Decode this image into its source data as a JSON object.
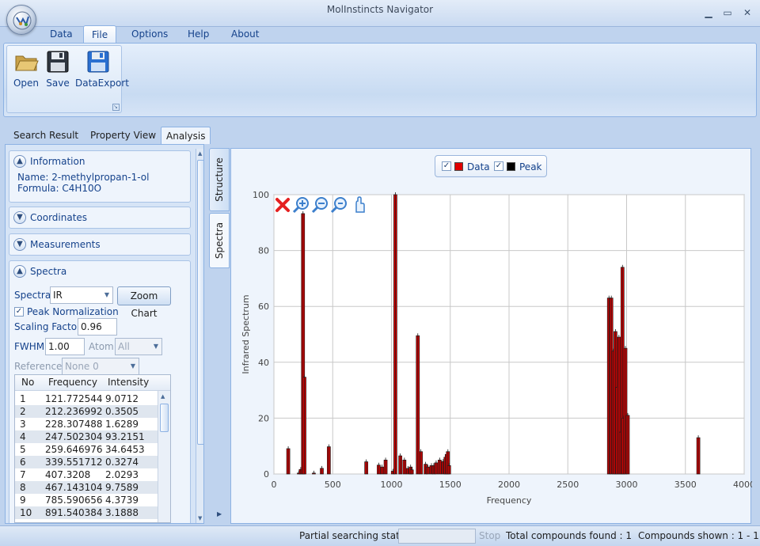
{
  "window": {
    "title": "MolInstincts Navigator",
    "min_glyph": "▁",
    "max_glyph": "▭",
    "close_glyph": "✕"
  },
  "menu": {
    "tabs": [
      "Data",
      "File",
      "Options",
      "Help",
      "About"
    ],
    "active": "File"
  },
  "ribbon": {
    "buttons": [
      {
        "label": "Open",
        "icon": "folder-open-icon"
      },
      {
        "label": "Save",
        "icon": "floppy-save-icon"
      },
      {
        "label": "DataExport",
        "icon": "data-export-icon"
      }
    ]
  },
  "page_tabs": {
    "items": [
      "Search Result",
      "Property View",
      "Analysis"
    ],
    "active": "Analysis"
  },
  "vertical_tabs": {
    "structure": "Structure",
    "spectra": "Spectra"
  },
  "left_panel": {
    "information": {
      "title": "Information",
      "name": "Name: 2-methylpropan-1-ol",
      "formula": "Formula: C4H10O"
    },
    "coordinates": {
      "title": "Coordinates"
    },
    "measurements": {
      "title": "Measurements"
    },
    "spectra": {
      "title": "Spectra",
      "spectra_label": "Spectra",
      "spectra_value": "IR",
      "zoom_button": "Zoom Chart",
      "peak_normalization_label": "Peak Normalization",
      "peak_normalization_glyph": "✓",
      "scaling_label": "Scaling Factor",
      "scaling_value": "0.96",
      "fwhm_label": "FWHM",
      "fwhm_value": "1.00",
      "atom_label": "Atom",
      "atom_value": "All",
      "reference_label": "Reference",
      "reference_value": "None  0"
    },
    "table": {
      "headers": [
        "No",
        "Frequency",
        "Intensity"
      ],
      "rows": [
        [
          "1",
          "121.772544",
          "9.0712"
        ],
        [
          "2",
          "212.236992",
          "0.3505"
        ],
        [
          "3",
          "228.307488",
          "1.6289"
        ],
        [
          "4",
          "247.502304",
          "93.2151"
        ],
        [
          "5",
          "259.646976",
          "34.6453"
        ],
        [
          "6",
          "339.551712",
          "0.3274"
        ],
        [
          "7",
          "407.3208",
          "2.0293"
        ],
        [
          "8",
          "467.143104",
          "9.7589"
        ],
        [
          "9",
          "785.590656",
          "4.3739"
        ],
        [
          "10",
          "891.540384",
          "3.1888"
        ]
      ]
    }
  },
  "chart_data": {
    "type": "bar",
    "title": "",
    "xlabel": "Frequency",
    "ylabel": "Infrared Spectrum",
    "xlim": [
      0,
      4000
    ],
    "ylim": [
      0,
      100
    ],
    "xticks": [
      "0",
      "500",
      "1000",
      "1500",
      "2000",
      "2500",
      "3000",
      "3500",
      "4000"
    ],
    "yticks": [
      "0",
      "20",
      "40",
      "60",
      "80",
      "100"
    ],
    "grid": true,
    "legend_placement": "top-center",
    "legend": [
      {
        "name": "Data",
        "color": "#e00000",
        "checked": "✓"
      },
      {
        "name": "Peak",
        "color": "#000000",
        "checked": "✓"
      }
    ],
    "toolbar_icons": [
      "reset-zoom-icon",
      "zoom-in-icon",
      "zoom-out-icon",
      "zoom-fit-icon",
      "pan-hand-icon"
    ],
    "bar_color": "#e00000",
    "bar_edge_color": "#1a1a1a",
    "series": [
      {
        "name": "Data",
        "x": [
          121.8,
          212.2,
          228.3,
          247.5,
          259.6,
          339.6,
          407.3,
          467.1,
          785.6,
          891.5,
          920,
          950,
          1012,
          1033,
          1075,
          1110,
          1140,
          1163,
          1173,
          1224,
          1250,
          1290,
          1310,
          1340,
          1360,
          1380,
          1410,
          1440,
          1460,
          1470,
          1480,
          1490,
          2850,
          2870,
          2890,
          2905,
          2920,
          2935,
          2950,
          2965,
          2975,
          2990,
          3010,
          3610
        ],
        "y": [
          9.07,
          0.35,
          1.63,
          93.22,
          34.65,
          0.33,
          2.03,
          9.76,
          4.37,
          3.19,
          2.5,
          5,
          1,
          100,
          6.5,
          5,
          2,
          2.5,
          1.5,
          49.5,
          8,
          3.5,
          2.5,
          3,
          3,
          4,
          5,
          4.5,
          6,
          7,
          8,
          3,
          63,
          63,
          44,
          51,
          31,
          49,
          15,
          74,
          20,
          45,
          21,
          13
        ]
      }
    ]
  },
  "status": {
    "partial_label": "Partial searching status :",
    "stop_label": "Stop",
    "total": "Total compounds found : 1",
    "shown": "Compounds shown : 1 - 1"
  }
}
